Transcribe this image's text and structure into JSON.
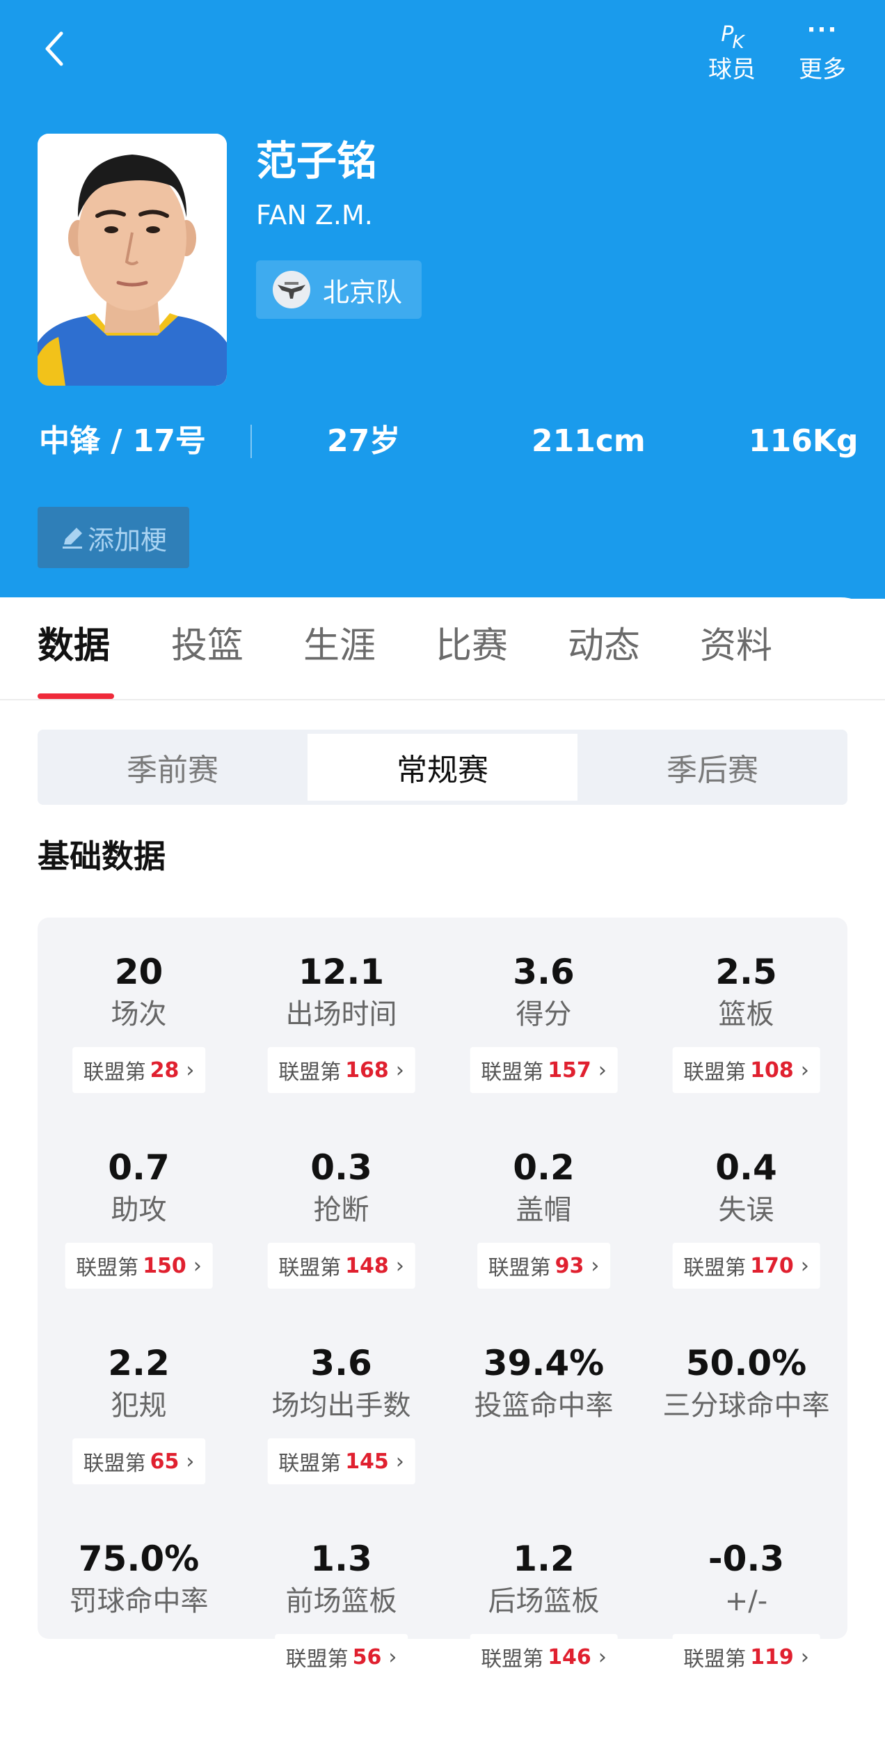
{
  "header": {
    "pk_label": "球员",
    "more_label": "更多",
    "pk_icon_text": "P",
    "pk_icon_sub": "K"
  },
  "player": {
    "name_cn": "范子铭",
    "name_en": "FAN Z.M.",
    "team": "北京队",
    "position_number": "中锋 / 17号",
    "age": "27岁",
    "height": "211cm",
    "weight": "116Kg",
    "add_tag_label": "添加梗"
  },
  "tabs": [
    "数据",
    "投篮",
    "生涯",
    "比赛",
    "动态",
    "资料"
  ],
  "season_tabs": [
    "季前赛",
    "常规赛",
    "季后赛"
  ],
  "section_title": "基础数据",
  "rank_prefix": "联盟第",
  "stats": [
    {
      "value": "20",
      "label": "场次",
      "rank": "28"
    },
    {
      "value": "12.1",
      "label": "出场时间",
      "rank": "168"
    },
    {
      "value": "3.6",
      "label": "得分",
      "rank": "157"
    },
    {
      "value": "2.5",
      "label": "篮板",
      "rank": "108"
    },
    {
      "value": "0.7",
      "label": "助攻",
      "rank": "150"
    },
    {
      "value": "0.3",
      "label": "抢断",
      "rank": "148"
    },
    {
      "value": "0.2",
      "label": "盖帽",
      "rank": "93"
    },
    {
      "value": "0.4",
      "label": "失误",
      "rank": "170"
    },
    {
      "value": "2.2",
      "label": "犯规",
      "rank": "65"
    },
    {
      "value": "3.6",
      "label": "场均出手数",
      "rank": "145"
    },
    {
      "value": "39.4%",
      "label": "投篮命中率",
      "rank": null
    },
    {
      "value": "50.0%",
      "label": "三分球命中率",
      "rank": null
    },
    {
      "value": "75.0%",
      "label": "罚球命中率",
      "rank": null
    },
    {
      "value": "1.3",
      "label": "前场篮板",
      "rank": "56"
    },
    {
      "value": "1.2",
      "label": "后场篮板",
      "rank": "146"
    },
    {
      "value": "-0.3",
      "label": "+/-",
      "rank": "119"
    }
  ],
  "colors": {
    "header_bg": "#1a9bec",
    "active_tab_indicator": "#ef2a3a",
    "rank_number": "#e0202f"
  }
}
